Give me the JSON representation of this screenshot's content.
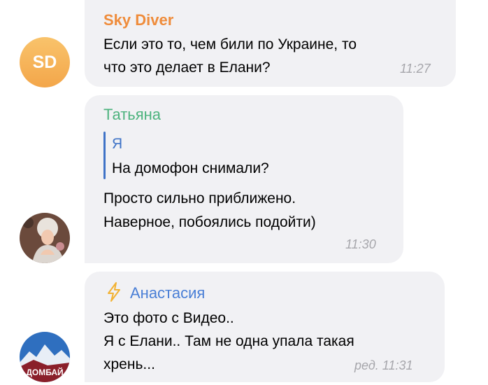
{
  "colors": {
    "bubble": "#f1f1f4",
    "sky_diver_name": "#ef8c3b",
    "tatyana_name": "#4db37e",
    "anastasia_name": "#4a7fd6",
    "reply_author": "#3f73c7",
    "time": "#a6a6ab"
  },
  "messages": [
    {
      "author": "Sky Diver",
      "avatar_initials": "SD",
      "lines": [
        "Если это то, чем били по Украине, то",
        "что это делает в Елани?"
      ],
      "time": "11:27"
    },
    {
      "author": "Татьяна",
      "reply_author": "Я",
      "reply_text": "На домофон снимали?",
      "lines": [
        "Просто сильно приближено.",
        "Наверное, побоялись подойти)"
      ],
      "time": "11:30"
    },
    {
      "author": "Анастасия",
      "author_icon": "lightning-icon",
      "lines": [
        "Это фото с Видео..",
        "Я с Елани.. Там не одна упала такая",
        "хрень..."
      ],
      "time": "ред. 11:31"
    }
  ]
}
